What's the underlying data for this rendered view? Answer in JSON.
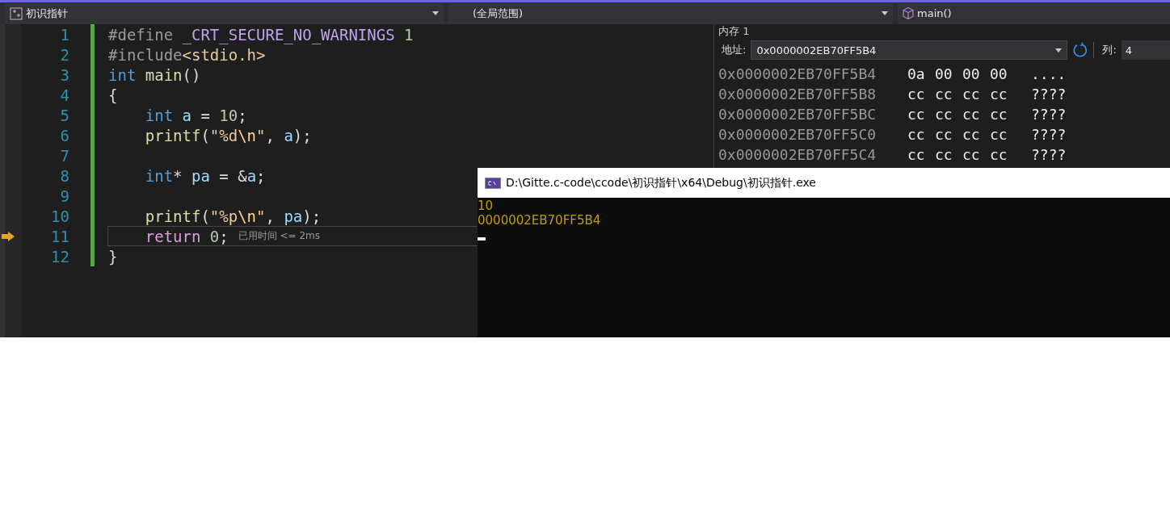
{
  "toolbar": {
    "project": "初识指针",
    "scope": "(全局范围)",
    "member": "main()"
  },
  "editor": {
    "lines": [
      {
        "number": "1",
        "current": false,
        "tokens": [
          {
            "kind": "pre",
            "text": "#define "
          },
          {
            "kind": "macro",
            "text": "_CRT_SECURE_NO_WARNINGS"
          },
          {
            "kind": "number",
            "text": " 1"
          }
        ]
      },
      {
        "number": "2",
        "current": false,
        "tokens": [
          {
            "kind": "pre",
            "text": "#include"
          },
          {
            "kind": "string",
            "text": "<stdio.h>"
          }
        ]
      },
      {
        "number": "3",
        "current": false,
        "tokens": [
          {
            "kind": "keyword",
            "text": "int "
          },
          {
            "kind": "function",
            "text": "main"
          },
          {
            "kind": "plain",
            "text": "()"
          }
        ]
      },
      {
        "number": "4",
        "current": false,
        "tokens": [
          {
            "kind": "plain",
            "text": "{"
          }
        ]
      },
      {
        "number": "5",
        "current": false,
        "tokens": [
          {
            "kind": "keyword",
            "text": "    int "
          },
          {
            "kind": "variable",
            "text": "a"
          },
          {
            "kind": "plain",
            "text": " = "
          },
          {
            "kind": "number",
            "text": "10"
          },
          {
            "kind": "plain",
            "text": ";"
          }
        ]
      },
      {
        "number": "6",
        "current": false,
        "tokens": [
          {
            "kind": "function",
            "text": "    printf"
          },
          {
            "kind": "plain",
            "text": "("
          },
          {
            "kind": "string",
            "text": "\"%d"
          },
          {
            "kind": "escape",
            "text": "\\n"
          },
          {
            "kind": "string",
            "text": "\""
          },
          {
            "kind": "plain",
            "text": ", "
          },
          {
            "kind": "variable",
            "text": "a"
          },
          {
            "kind": "plain",
            "text": ");"
          }
        ]
      },
      {
        "number": "7",
        "current": false
      },
      {
        "number": "8",
        "current": false,
        "tokens": [
          {
            "kind": "keyword",
            "text": "    int"
          },
          {
            "kind": "plain",
            "text": "* "
          },
          {
            "kind": "variable",
            "text": "pa"
          },
          {
            "kind": "plain",
            "text": " = &"
          },
          {
            "kind": "variable",
            "text": "a"
          },
          {
            "kind": "plain",
            "text": ";"
          }
        ]
      },
      {
        "number": "9",
        "current": false
      },
      {
        "number": "10",
        "current": false,
        "tokens": [
          {
            "kind": "function",
            "text": "    printf"
          },
          {
            "kind": "plain",
            "text": "("
          },
          {
            "kind": "string",
            "text": "\"%p"
          },
          {
            "kind": "escape",
            "text": "\\n"
          },
          {
            "kind": "string",
            "text": "\""
          },
          {
            "kind": "plain",
            "text": ", "
          },
          {
            "kind": "variable",
            "text": "pa"
          },
          {
            "kind": "plain",
            "text": ");"
          }
        ]
      },
      {
        "number": "11",
        "current": true,
        "hint": "已用时间 <= 2ms",
        "tokens": [
          {
            "kind": "control",
            "text": "    return "
          },
          {
            "kind": "number",
            "text": "0"
          },
          {
            "kind": "plain",
            "text": ";"
          }
        ]
      },
      {
        "number": "12",
        "current": false,
        "tokens": [
          {
            "kind": "plain",
            "text": "}"
          }
        ]
      }
    ]
  },
  "memory_window": {
    "title": "内存 1",
    "address_label": "地址:",
    "address": "0x0000002EB70FF5B4",
    "columns_label": "列:",
    "columns": "4",
    "rows": [
      {
        "address": "0x0000002EB70FF5B4",
        "bytes": [
          "0a",
          "00",
          "00",
          "00"
        ],
        "text": "...."
      },
      {
        "address": "0x0000002EB70FF5B8",
        "bytes": [
          "cc",
          "cc",
          "cc",
          "cc"
        ],
        "text": "????"
      },
      {
        "address": "0x0000002EB70FF5BC",
        "bytes": [
          "cc",
          "cc",
          "cc",
          "cc"
        ],
        "text": "????"
      },
      {
        "address": "0x0000002EB70FF5C0",
        "bytes": [
          "cc",
          "cc",
          "cc",
          "cc"
        ],
        "text": "????"
      },
      {
        "address": "0x0000002EB70FF5C4",
        "bytes": [
          "cc",
          "cc",
          "cc",
          "cc"
        ],
        "text": "????"
      }
    ]
  },
  "console": {
    "title": "D:\\Gitte.c-code\\ccode\\初识指针\\x64\\Debug\\初识指针.exe",
    "output": [
      "10",
      "0000002EB70FF5B4"
    ]
  }
}
